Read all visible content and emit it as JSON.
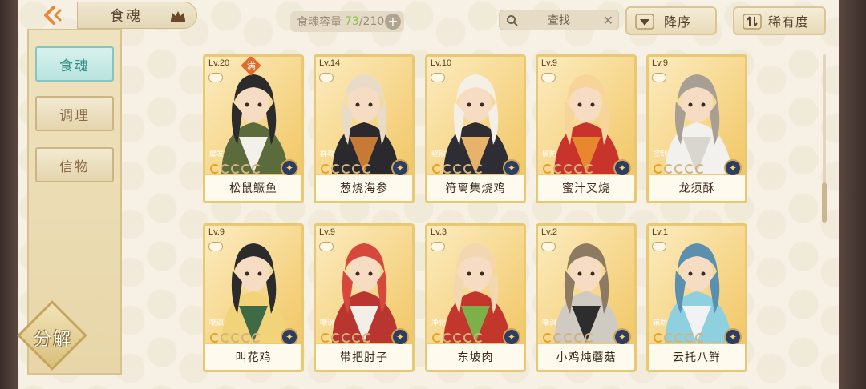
{
  "header": {
    "title": "食魂",
    "capacity_label": "食魂容量",
    "capacity_current": "73",
    "capacity_sep_max": "/210",
    "add_label": "+",
    "search_label": "查找",
    "sort_order_label": "降序",
    "sort_rarity_label": "稀有度"
  },
  "sidebar": {
    "items": [
      {
        "label": "食魂",
        "active": true
      },
      {
        "label": "调理",
        "active": false
      },
      {
        "label": "信物",
        "active": false
      }
    ],
    "decompose_label": "分解"
  },
  "cards": [
    {
      "level": "Lv.20",
      "max_badge": "满",
      "tag": "爆发",
      "name": "松鼠鳜鱼",
      "stars": 5,
      "lit": 1,
      "colors": [
        "#5c6b3c",
        "#f2f0e8",
        "#2b2b2b"
      ]
    },
    {
      "level": "Lv.14",
      "max_badge": "",
      "tag": "群攻",
      "name": "葱烧海参",
      "stars": 5,
      "lit": 1,
      "colors": [
        "#2a2a2e",
        "#c77a33",
        "#e8dcc8"
      ]
    },
    {
      "level": "Lv.10",
      "max_badge": "",
      "tag": "驱散",
      "name": "符离集烧鸡",
      "stars": 5,
      "lit": 1,
      "colors": [
        "#2d2d33",
        "#e7b36a",
        "#f4f0e6"
      ]
    },
    {
      "level": "Lv.9",
      "max_badge": "",
      "tag": "破防",
      "name": "蜜汁叉烧",
      "stars": 5,
      "lit": 1,
      "colors": [
        "#c8332c",
        "#e8882e",
        "#f7d59a"
      ]
    },
    {
      "level": "Lv.9",
      "max_badge": "",
      "tag": "控制",
      "name": "龙须酥",
      "stars": 5,
      "lit": 1,
      "colors": [
        "#f3f1ee",
        "#d9d6cf",
        "#a89f94"
      ]
    },
    {
      "level": "Lv.9",
      "max_badge": "",
      "tag": "嘲讽",
      "name": "叫花鸡",
      "stars": 5,
      "lit": 1,
      "colors": [
        "#f1d37a",
        "#3e6b46",
        "#2b2b2b"
      ]
    },
    {
      "level": "Lv.9",
      "max_badge": "",
      "tag": "嘲讽",
      "name": "带把肘子",
      "stars": 5,
      "lit": 1,
      "colors": [
        "#b8362f",
        "#f4efe6",
        "#d6483c"
      ]
    },
    {
      "level": "Lv.3",
      "max_badge": "",
      "tag": "净化",
      "name": "东坡肉",
      "stars": 5,
      "lit": 1,
      "colors": [
        "#c2362b",
        "#7eb04a",
        "#f1d8b0"
      ]
    },
    {
      "level": "Lv.2",
      "max_badge": "",
      "tag": "嘲讽",
      "name": "小鸡炖蘑菇",
      "stars": 5,
      "lit": 1,
      "colors": [
        "#cfcac2",
        "#2d2d2d",
        "#8d7a62"
      ]
    },
    {
      "level": "Lv.1",
      "max_badge": "",
      "tag": "辅助",
      "name": "云托八鲜",
      "stars": 5,
      "lit": 1,
      "colors": [
        "#8fd0e0",
        "#f0f2f4",
        "#5b8fb0"
      ]
    }
  ],
  "colors": {
    "accent_teal": "#2f8f87",
    "card_border": "#e8c873",
    "capacity_current": "#8bc34a"
  }
}
